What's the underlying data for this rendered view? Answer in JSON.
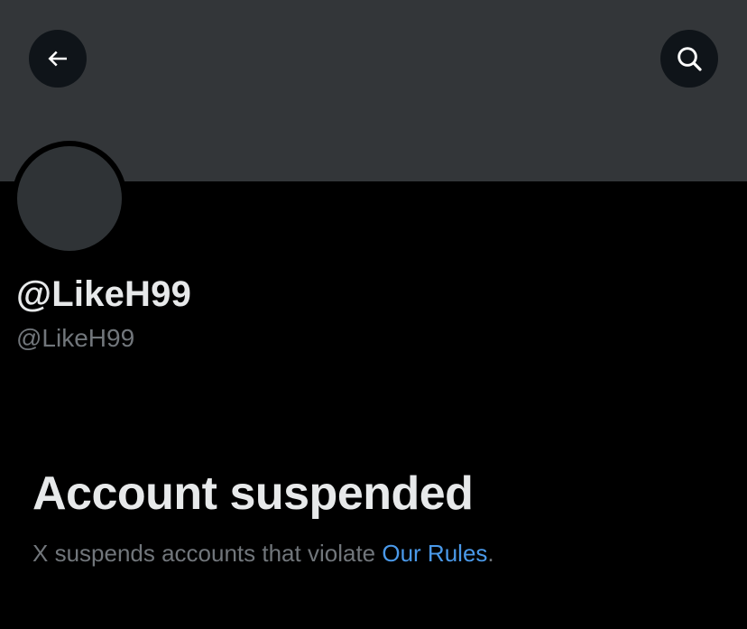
{
  "header": {
    "back_icon": "arrow-left-icon",
    "search_icon": "search-icon"
  },
  "profile": {
    "display_name": "@LikeH99",
    "handle": "@LikeH99"
  },
  "suspension": {
    "title": "Account suspended",
    "message_prefix": "X suspends accounts that violate ",
    "link_text": "Our Rules",
    "message_suffix": "."
  },
  "colors": {
    "background": "#000000",
    "banner": "#333639",
    "avatar": "#2f3336",
    "primary_text": "#e7e9ea",
    "secondary_text": "#71767b",
    "link": "#4a99e9"
  }
}
